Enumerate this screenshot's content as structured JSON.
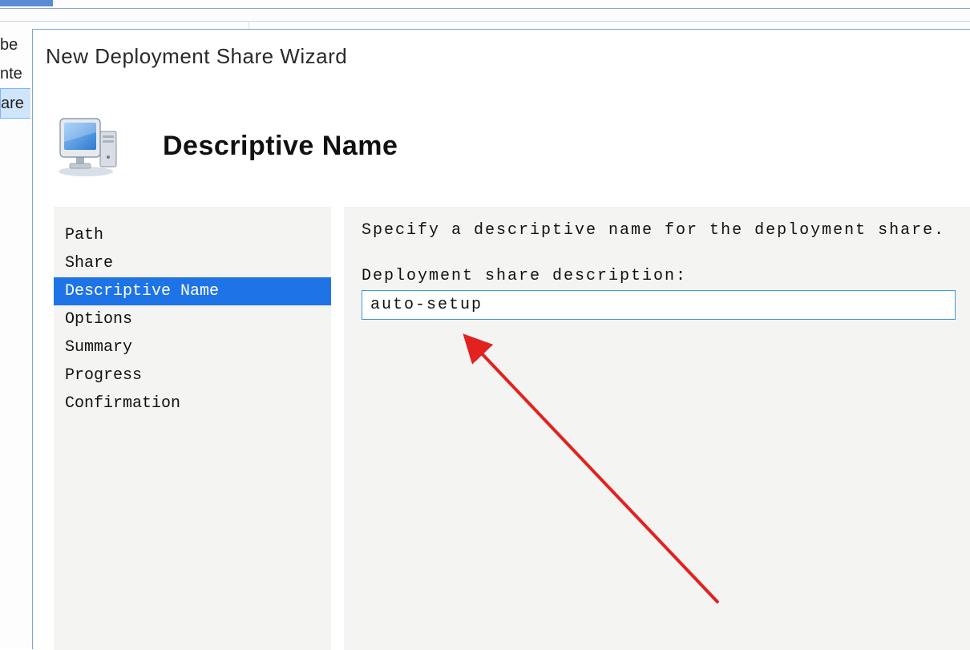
{
  "background_list": {
    "items": [
      "be",
      "nte",
      "are"
    ],
    "selected_index": 2
  },
  "wizard": {
    "title": "New Deployment Share Wizard",
    "page_heading": "Descriptive Name",
    "icon_name": "computer-monitor-icon",
    "steps": [
      {
        "label": "Path",
        "active": false
      },
      {
        "label": "Share",
        "active": false
      },
      {
        "label": "Descriptive Name",
        "active": true
      },
      {
        "label": "Options",
        "active": false
      },
      {
        "label": "Summary",
        "active": false
      },
      {
        "label": "Progress",
        "active": false
      },
      {
        "label": "Confirmation",
        "active": false
      }
    ],
    "instruction": "Specify a descriptive name for the deployment share.",
    "field_label": "Deployment share description:",
    "field_value": "auto-setup"
  },
  "annotation": {
    "type": "arrow",
    "color": "#e2221f"
  }
}
